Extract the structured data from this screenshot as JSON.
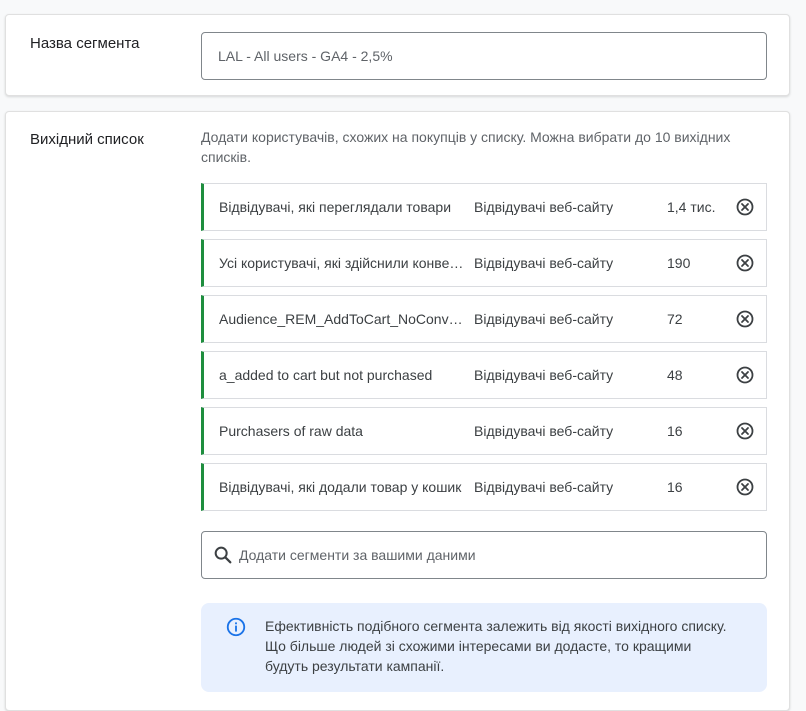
{
  "segment_name": {
    "label": "Назва сегмента",
    "value": "LAL - All users - GA4 - 2,5%"
  },
  "source_list": {
    "label": "Вихідний список",
    "description": "Додати користувачів, схожих на покупців у списку. Можна вибрати до 10 вихідних списків.",
    "rows": [
      {
        "name": "Відвідувачі, які переглядали товари",
        "type": "Відвідувачі веб-сайту",
        "size": "1,4 тис."
      },
      {
        "name": "Усі користувачі, які здійснили конверсію",
        "type": "Відвідувачі веб-сайту",
        "size": "190"
      },
      {
        "name": "Audience_REM_AddToCart_NoConversion",
        "type": "Відвідувачі веб-сайту",
        "size": "72"
      },
      {
        "name": "a_added to cart but not purchased",
        "type": "Відвідувачі веб-сайту",
        "size": "48"
      },
      {
        "name": "Purchasers of raw data",
        "type": "Відвідувачі веб-сайту",
        "size": "16"
      },
      {
        "name": "Відвідувачі, які додали товар у кошик",
        "type": "Відвідувачі веб-сайту",
        "size": "16"
      }
    ],
    "search": {
      "placeholder": "Додати сегменти за вашими даними",
      "icon": "search-icon"
    },
    "info": {
      "icon": "info-icon",
      "text": "Ефективність подібного сегмента залежить від якості вихідного списку. Що більше людей зі схожими інтересами ви додасте, то кращими будуть результати кампанії."
    }
  },
  "colors": {
    "accent_green": "#1e8e3e",
    "info_blue": "#1a73e8",
    "info_bg": "#e8f0fe"
  }
}
